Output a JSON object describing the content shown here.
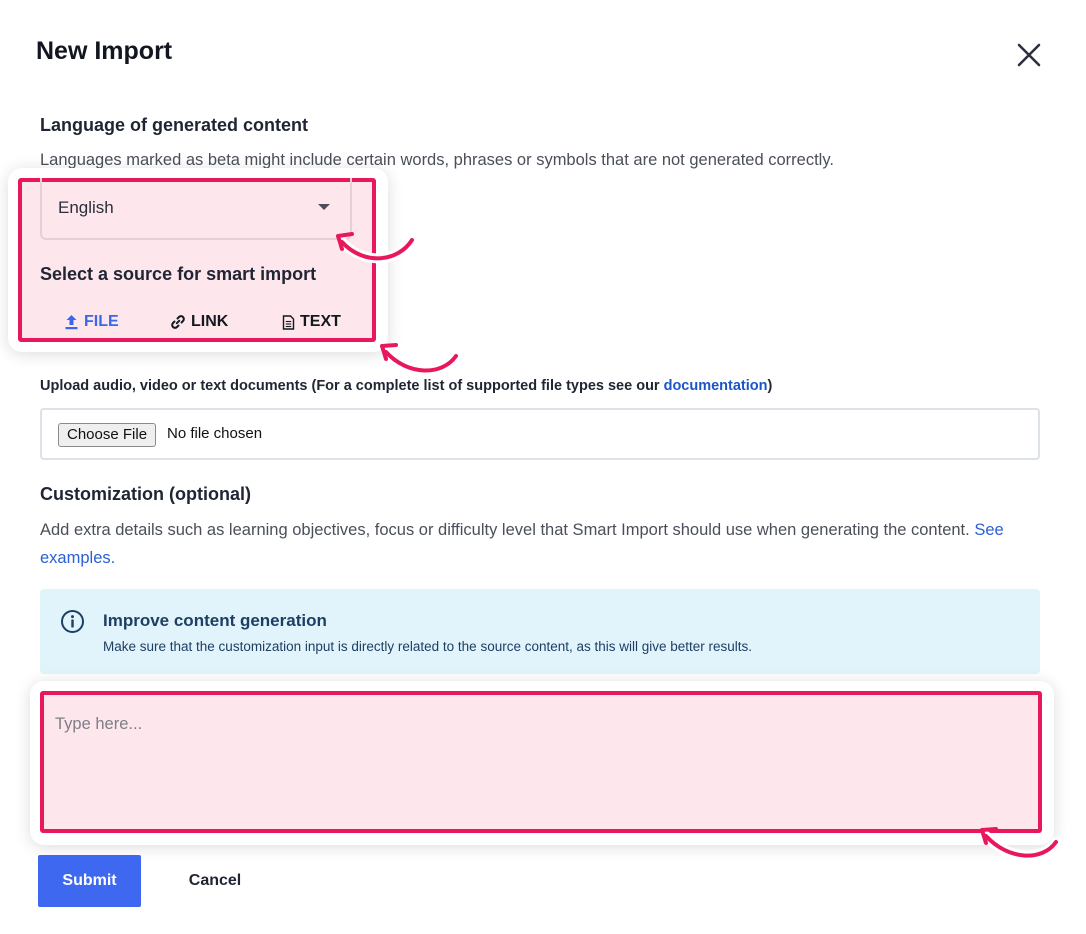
{
  "dialog": {
    "title": "New Import"
  },
  "language": {
    "heading": "Language of generated content",
    "description": "Languages marked as beta might include certain words, phrases or symbols that are not generated correctly.",
    "selected": "English"
  },
  "source": {
    "heading": "Select a source for smart import",
    "tabs": [
      {
        "label": "FILE",
        "icon": "upload-icon",
        "active": true
      },
      {
        "label": "LINK",
        "icon": "link-icon",
        "active": false
      },
      {
        "label": "TEXT",
        "icon": "document-icon",
        "active": false
      }
    ]
  },
  "upload": {
    "label": "Upload audio, video or text documents (For a complete list of supported file types see our ",
    "link_text": "documentation",
    "label_end": ")",
    "choose_button": "Choose File",
    "file_status": "No file chosen"
  },
  "customization": {
    "heading": "Customization (optional)",
    "description": "Add extra details such as learning objectives, focus or difficulty level that Smart Import should use when generating the content.",
    "examples_link": "See examples."
  },
  "info": {
    "title": "Improve content generation",
    "text": "Make sure that the customization input is directly related to the source content, as this will give better results."
  },
  "input": {
    "placeholder": "Type here..."
  },
  "actions": {
    "submit_label": "Submit",
    "cancel_label": "Cancel"
  },
  "colors": {
    "accent_blue": "#3e68f0",
    "highlight_pink": "#e8185d",
    "highlight_fill": "#fde6ec",
    "info_bg": "#e1f3fb"
  }
}
